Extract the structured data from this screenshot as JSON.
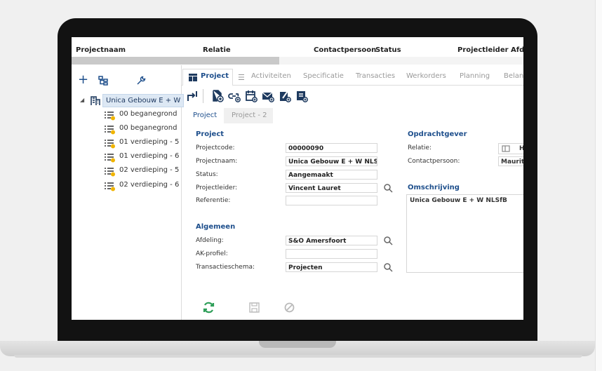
{
  "header": {
    "columns": [
      "Projectnaam",
      "Relatie",
      "Contactpersoon",
      "Status",
      "Projectleider",
      "Afd"
    ]
  },
  "tree": {
    "root_label": "Unica Gebouw E + W",
    "items": [
      "00 beganegrond",
      "00 beganegrond",
      "01 verdieping - 5",
      "01 verdieping - 6",
      "02 verdieping - 5",
      "02 verdieping - 6"
    ]
  },
  "tabs": [
    "Project",
    "Activiteiten",
    "Specificatie",
    "Transacties",
    "Werkorders",
    "Planning",
    "Belang"
  ],
  "subtabs": [
    "Project",
    "Project - 2"
  ],
  "form": {
    "project_heading": "Project",
    "projectcode_label": "Projectcode:",
    "projectcode_value": "00000090",
    "projectnaam_label": "Projectnaam:",
    "projectnaam_value": "Unica Gebouw E + W NLSfB",
    "status_label": "Status:",
    "status_value": "Aangemaakt",
    "projectleider_label": "Projectleider:",
    "projectleider_value": "Vincent Lauret",
    "referentie_label": "Referentie:",
    "referentie_value": "",
    "algemeen_heading": "Algemeen",
    "afdeling_label": "Afdeling:",
    "afdeling_value": "S&O Amersfoort",
    "akprofiel_label": "AK-profiel:",
    "akprofiel_value": "",
    "transactieschema_label": "Transactieschema:",
    "transactieschema_value": "Projecten",
    "opdrachtgever_heading": "Opdrachtgever",
    "relatie_label": "Relatie:",
    "relatie_value": "H",
    "contactpersoon_label": "Contactpersoon:",
    "contactpersoon_value": "Maurits",
    "omschrijving_heading": "Omschrijving",
    "omschrijving_value": "Unica Gebouw E + W NLSfB"
  },
  "colors": {
    "accent": "#1e4f8c",
    "refresh": "#2e9e58",
    "tree_selected_bg": "#dde8f4"
  }
}
